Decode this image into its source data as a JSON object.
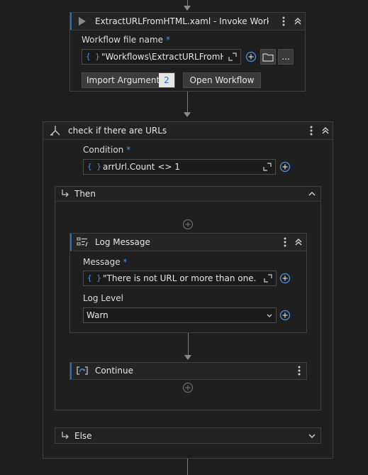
{
  "invoke": {
    "title": "ExtractURLFromHTML.xaml - Invoke Workfl...",
    "file_label": "Workflow file name",
    "required_mark": "*",
    "file_value": "\"Workflows\\ExtractURLFromHTM",
    "brace": "{ }",
    "import_label": "Import Arguments",
    "import_count": "2",
    "open_label": "Open Workflow",
    "more_label": "..."
  },
  "ifblock": {
    "title": "check if there are URLs",
    "condition_label": "Condition",
    "required_mark": "*",
    "brace": "{ }",
    "condition_value": "arrUrl.Count <> 1",
    "then_label": "Then",
    "else_label": "Else"
  },
  "log": {
    "title": "Log Message",
    "message_label": "Message",
    "required_mark": "*",
    "brace": "{ }",
    "message_value": "\"There is not URL or more than one. Not p",
    "level_label": "Log Level",
    "level_value": "Warn"
  },
  "cont": {
    "title": "Continue"
  },
  "colors": {
    "background": "#1e1e1e",
    "accent": "#2f6fb4",
    "brace": "#4d8fe0"
  }
}
